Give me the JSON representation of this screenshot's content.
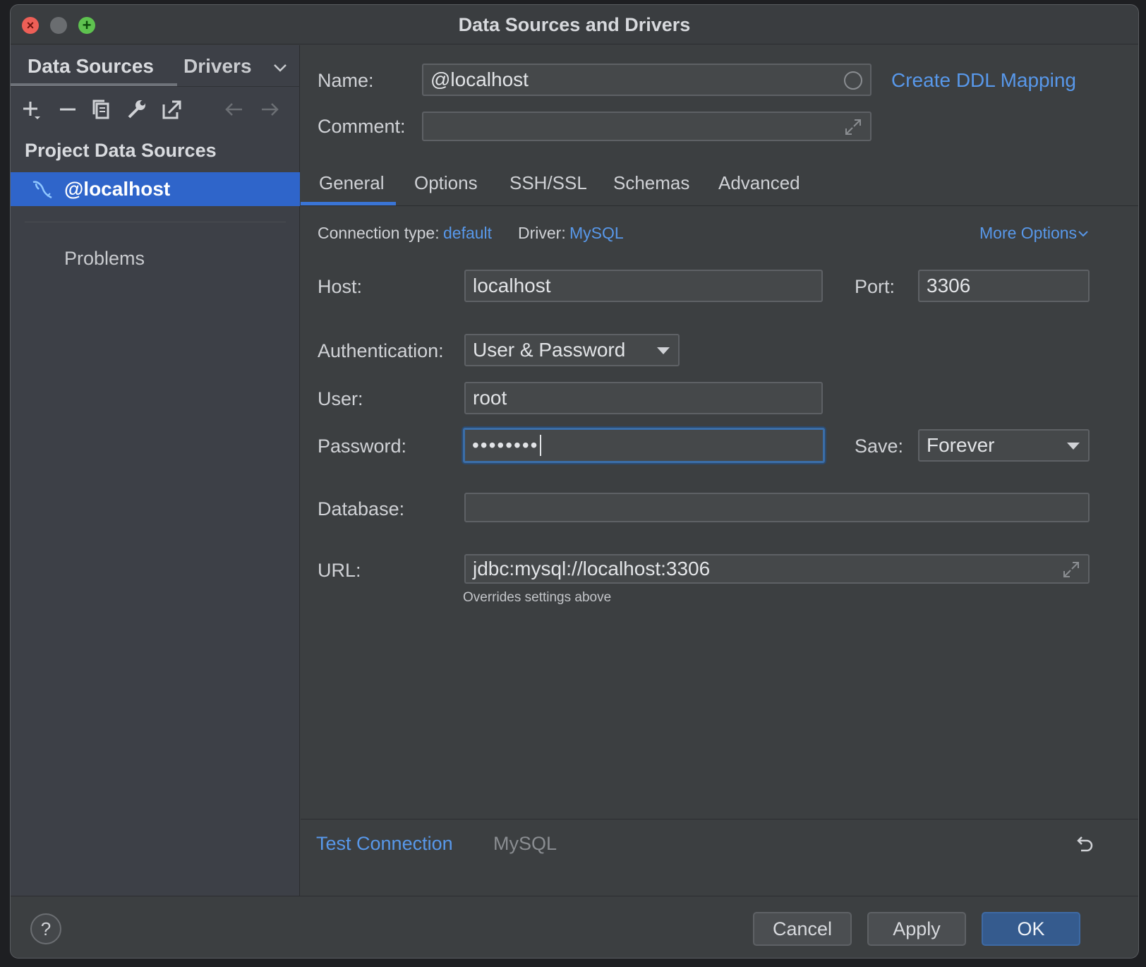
{
  "window": {
    "title": "Data Sources and Drivers"
  },
  "left": {
    "tabs": [
      "Data Sources",
      "Drivers"
    ],
    "section_title": "Project Data Sources",
    "selected_item": "@localhost",
    "problems": "Problems"
  },
  "form": {
    "name_label": "Name:",
    "name_value": "@localhost",
    "create_ddl": "Create DDL Mapping",
    "comment_label": "Comment:",
    "comment_value": "",
    "tabs": [
      "General",
      "Options",
      "SSH/SSL",
      "Schemas",
      "Advanced"
    ],
    "active_tab": "General",
    "connection_type_label": "Connection type:",
    "connection_type_value": "default",
    "driver_label": "Driver:",
    "driver_value": "MySQL",
    "more_options": "More Options",
    "host_label": "Host:",
    "host_value": "localhost",
    "port_label": "Port:",
    "port_value": "3306",
    "auth_label": "Authentication:",
    "auth_value": "User & Password",
    "user_label": "User:",
    "user_value": "root",
    "password_label": "Password:",
    "password_value": "••••••••",
    "save_label": "Save:",
    "save_value": "Forever",
    "database_label": "Database:",
    "database_value": "",
    "url_label": "URL:",
    "url_value": "jdbc:mysql://localhost:3306",
    "url_hint": "Overrides settings above"
  },
  "bottom": {
    "test_connection": "Test Connection",
    "driver_name": "MySQL"
  },
  "footer": {
    "help": "?",
    "cancel": "Cancel",
    "apply": "Apply",
    "ok": "OK"
  },
  "colors": {
    "accent": "#2f65ca",
    "link": "#5898ea",
    "background": "#3c3f41"
  }
}
